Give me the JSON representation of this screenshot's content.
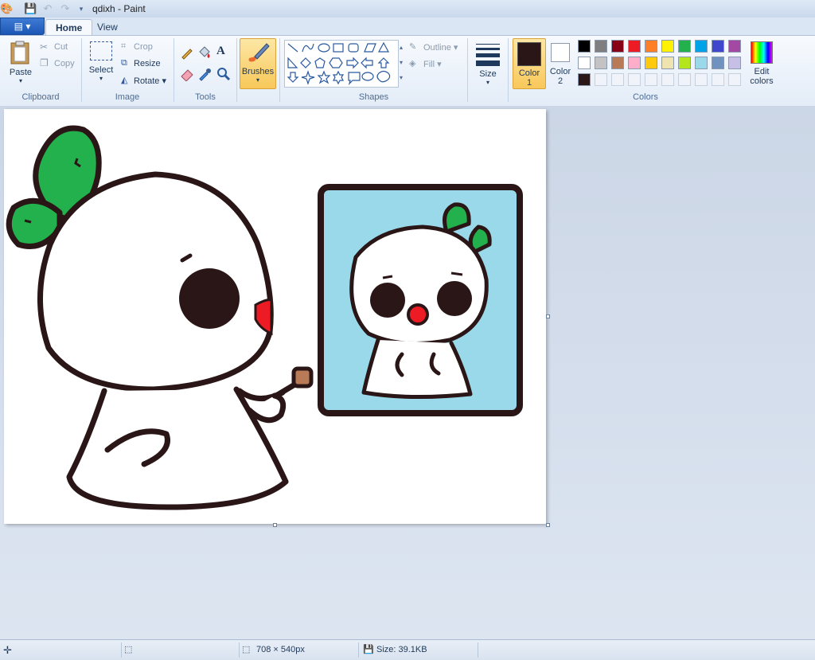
{
  "window": {
    "title": "qdixh - Paint"
  },
  "tabs": [
    {
      "label": "Home",
      "active": true
    },
    {
      "label": "View",
      "active": false
    }
  ],
  "clipboard": {
    "group": "Clipboard",
    "paste": "Paste",
    "cut": "Cut",
    "copy": "Copy"
  },
  "image": {
    "group": "Image",
    "select": "Select",
    "crop": "Crop",
    "resize": "Resize",
    "rotate": "Rotate"
  },
  "tools": {
    "group": "Tools"
  },
  "brushes": {
    "label": "Brushes"
  },
  "shapes": {
    "group": "Shapes",
    "outline": "Outline",
    "fill": "Fill"
  },
  "size": {
    "label": "Size"
  },
  "colors": {
    "group": "Colors",
    "color1": "Color 1",
    "color2": "Color 2",
    "edit": "Edit colors",
    "color1_value": "#2a1616",
    "color2_value": "#ffffff",
    "palette_row1": [
      "#000000",
      "#7f7f7f",
      "#880015",
      "#ed1c24",
      "#ff7f27",
      "#fff200",
      "#22b14c",
      "#00a2e8",
      "#3f48cc",
      "#a349a4"
    ],
    "palette_row2": [
      "#ffffff",
      "#c3c3c3",
      "#b97a57",
      "#ffaec9",
      "#ffc90e",
      "#efe4b0",
      "#b5e61d",
      "#99d9ea",
      "#7092be",
      "#c8bfe7"
    ],
    "palette_row3": [
      "#2a1616"
    ]
  },
  "status": {
    "dimensions": "708 × 540px",
    "size": "Size: 39.1KB"
  },
  "icons": [
    "paint-menu-icon",
    "save-icon",
    "undo-icon",
    "redo-icon",
    "paste-icon",
    "cut-icon",
    "copy-icon",
    "select-icon",
    "crop-icon",
    "resize-icon",
    "rotate-icon",
    "pencil-icon",
    "fill-icon",
    "text-icon",
    "eraser-icon",
    "color-picker-icon",
    "magnifier-icon",
    "brush-icon",
    "outline-icon",
    "fill-shape-icon",
    "size-icon",
    "edit-colors-icon",
    "cursor-position-icon",
    "selection-size-icon",
    "image-size-icon",
    "file-size-icon"
  ]
}
